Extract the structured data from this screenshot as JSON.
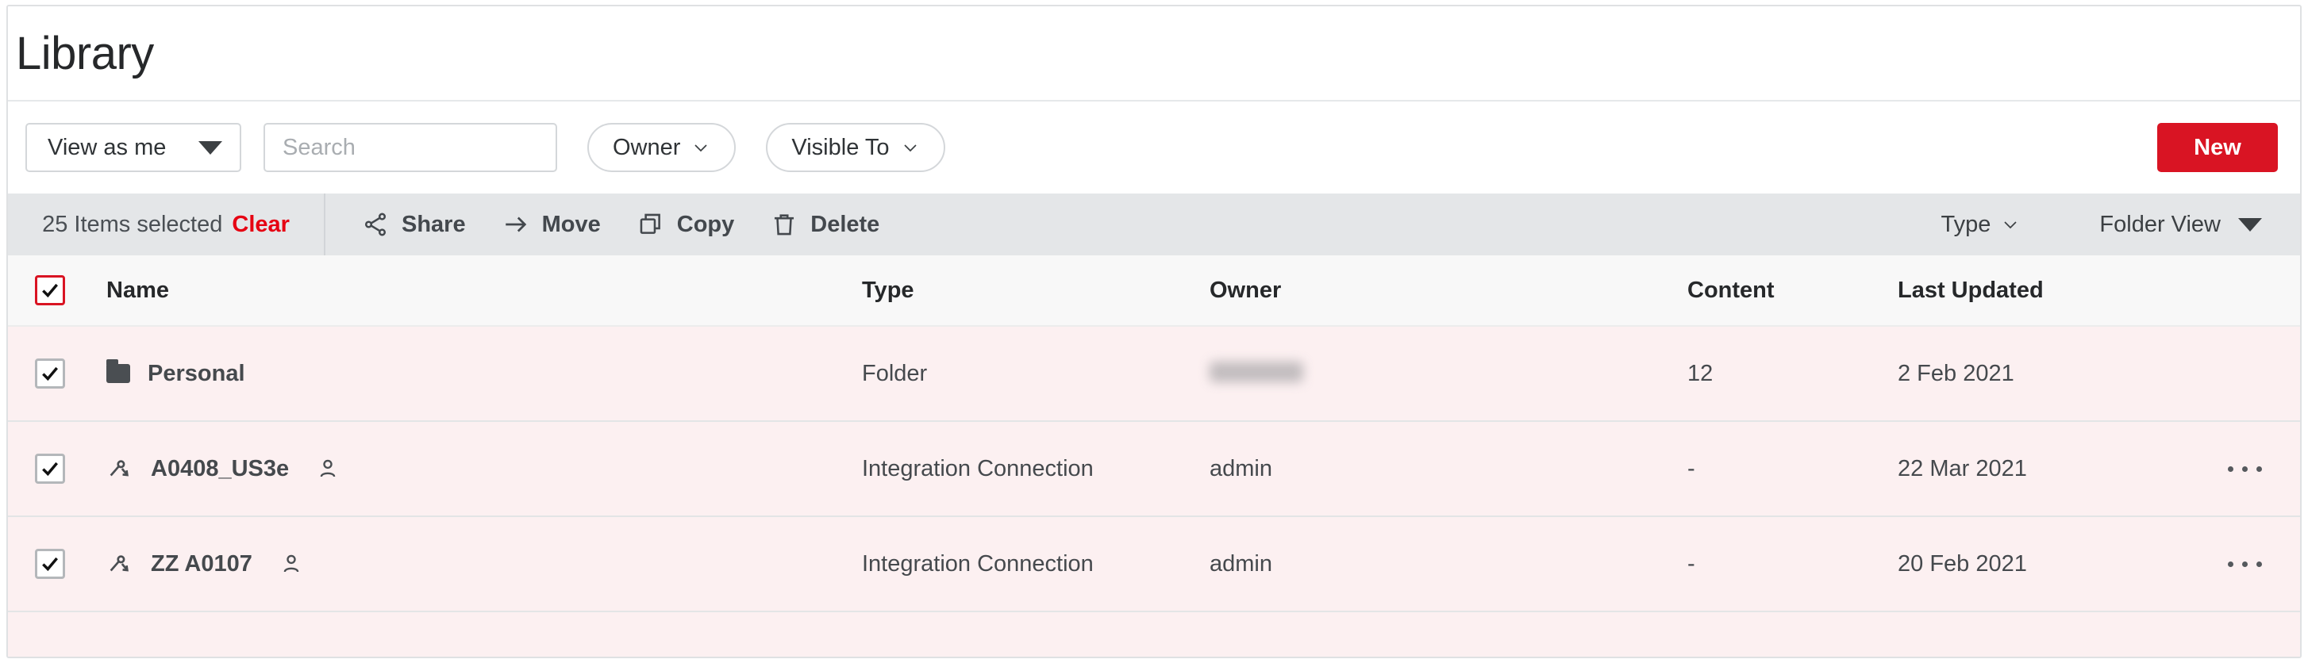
{
  "page": {
    "title": "Library"
  },
  "filters": {
    "view_as": {
      "label": "View as me",
      "icon": "triangle-down-icon"
    },
    "search": {
      "value": "",
      "placeholder": "Search",
      "icon": "search-icon"
    },
    "owner": {
      "label": "Owner",
      "icon": "chevron-down-icon"
    },
    "visible_to": {
      "label": "Visible To",
      "icon": "chevron-down-icon"
    },
    "new_button": {
      "label": "New",
      "color": "#d91423"
    }
  },
  "action_bar": {
    "selection_text": "25 Items selected",
    "clear_label": "Clear",
    "clear_color": "#e60012",
    "actions": [
      {
        "label": "Share",
        "icon": "share-nodes-icon"
      },
      {
        "label": "Move",
        "icon": "arrow-right-icon"
      },
      {
        "label": "Copy",
        "icon": "copy-icon"
      },
      {
        "label": "Delete",
        "icon": "trash-icon"
      }
    ],
    "type_filter": {
      "label": "Type",
      "icon": "chevron-down-icon"
    },
    "view_mode": {
      "label": "Folder View",
      "icon": "triangle-down-icon"
    }
  },
  "table": {
    "columns": [
      {
        "key": "name",
        "label": "Name"
      },
      {
        "key": "type",
        "label": "Type"
      },
      {
        "key": "owner",
        "label": "Owner"
      },
      {
        "key": "content",
        "label": "Content"
      },
      {
        "key": "updated",
        "label": "Last Updated"
      }
    ],
    "header_checkbox": {
      "checked": true,
      "state": "all-selected"
    },
    "rows": [
      {
        "checked": true,
        "leading_icon": "folder-icon",
        "name": "Personal",
        "trailing_icon": null,
        "type": "Folder",
        "owner": "",
        "owner_redacted": true,
        "content": "12",
        "updated": "2 Feb 2021",
        "has_kebab": false
      },
      {
        "checked": true,
        "leading_icon": "connection-icon",
        "name": "A0408_US3e",
        "trailing_icon": "person-icon",
        "type": "Integration Connection",
        "owner": "admin",
        "owner_redacted": false,
        "content": "-",
        "updated": "22 Mar 2021",
        "has_kebab": true,
        "kebab_icon": "more-horizontal-icon"
      },
      {
        "checked": true,
        "leading_icon": "connection-icon",
        "name": "ZZ A0107",
        "trailing_icon": "person-icon",
        "type": "Integration Connection",
        "owner": "admin",
        "owner_redacted": false,
        "content": "-",
        "updated": "20 Feb 2021",
        "has_kebab": true,
        "kebab_icon": "more-horizontal-icon"
      }
    ]
  }
}
